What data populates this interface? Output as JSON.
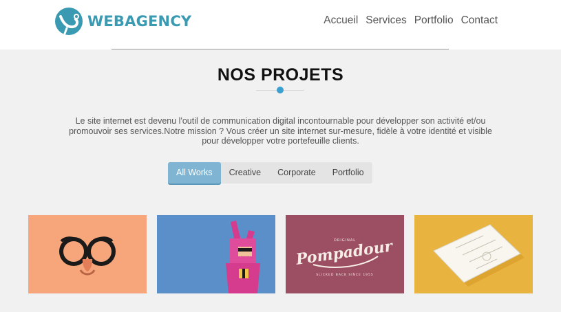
{
  "brand": {
    "name": "WEBAGENCY"
  },
  "nav": {
    "items": [
      {
        "label": "Accueil"
      },
      {
        "label": "Services"
      },
      {
        "label": "Portfolio"
      },
      {
        "label": "Contact"
      }
    ]
  },
  "projects": {
    "title": "NOS PROJETS",
    "intro": "Le site internet est devenu l'outil de communication digital incontournable pour développer son activité et/ou promouvoir ses services.Notre mission ? Vous créer un site internet sur-mesure, fidèle à votre identité et visible pour développer votre portefeuille clients.",
    "filters": [
      {
        "label": "All Works",
        "active": true
      },
      {
        "label": "Creative",
        "active": false
      },
      {
        "label": "Corporate",
        "active": false
      },
      {
        "label": "Portfolio",
        "active": false
      }
    ],
    "works": [
      {
        "icon": "glasses-mustache-illustration",
        "background": "#f7a57a"
      },
      {
        "icon": "pink-bunny-character-illustration",
        "background": "#5b8fc9"
      },
      {
        "icon": "pompadour-logo-illustration",
        "background": "#9c4f62",
        "logo_text": "Pompadour",
        "logo_top": "ORIGINAL",
        "logo_bottom": "SLICKED BACK SINCE 1955"
      },
      {
        "icon": "business-card-illustration",
        "background": "#e8b33e"
      }
    ]
  },
  "colors": {
    "brand": "#3a9ab2",
    "accent": "#3aa0cf",
    "filter_active": "#7fb5d3",
    "page_bg": "#f1f1f1"
  }
}
